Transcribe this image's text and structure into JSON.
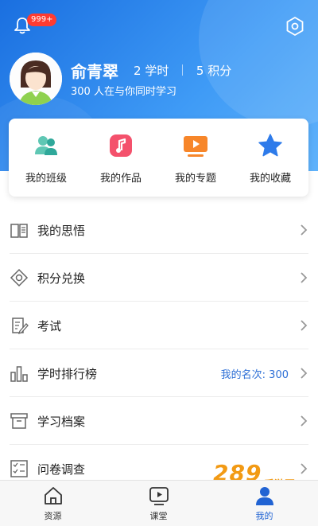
{
  "header": {
    "notification_badge": "999+",
    "username": "俞青翠",
    "study_hours_value": "2",
    "study_hours_unit": "学时",
    "points_value": "5",
    "points_unit": "积分",
    "online_text": "300 人在与你同时学习"
  },
  "quick_actions": [
    {
      "label": "我的班级",
      "icon": "class-icon"
    },
    {
      "label": "我的作品",
      "icon": "music-note-icon"
    },
    {
      "label": "我的专题",
      "icon": "video-player-icon"
    },
    {
      "label": "我的收藏",
      "icon": "star-icon"
    }
  ],
  "menu": [
    {
      "label": "我的思悟",
      "icon": "book-icon",
      "extra": ""
    },
    {
      "label": "积分兑换",
      "icon": "diamond-icon",
      "extra": ""
    },
    {
      "label": "考试",
      "icon": "exam-icon",
      "extra": ""
    },
    {
      "label": "学时排行榜",
      "icon": "bar-chart-icon",
      "extra": "我的名次: 300"
    },
    {
      "label": "学习档案",
      "icon": "archive-icon",
      "extra": ""
    },
    {
      "label": "问卷调查",
      "icon": "checklist-icon",
      "extra": ""
    }
  ],
  "tabs": [
    {
      "label": "资源",
      "icon": "home-icon",
      "active": false
    },
    {
      "label": "课堂",
      "icon": "play-icon",
      "active": false
    },
    {
      "label": "我的",
      "icon": "person-icon",
      "active": true
    }
  ],
  "watermark": {
    "text": "289",
    "sub": "手游网"
  },
  "colors": {
    "header_blue": "#1a6fe0",
    "accent_blue": "#2163d3",
    "badge_red": "#ff3b30",
    "watermark_orange": "#f29a14"
  }
}
